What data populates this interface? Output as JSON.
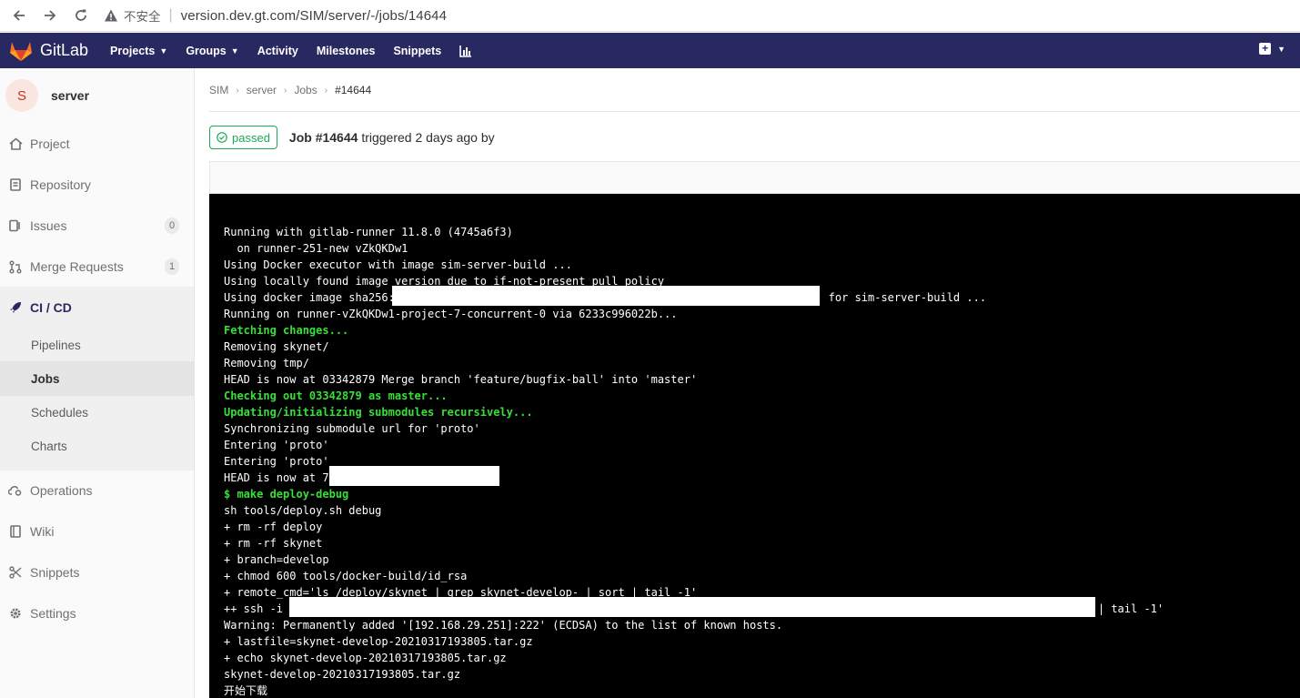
{
  "browser": {
    "insecure_label": "不安全",
    "url": "version.dev.gt.com/SIM/server/-/jobs/14644"
  },
  "topnav": {
    "brand": "GitLab",
    "items": [
      {
        "label": "Projects",
        "dropdown": true
      },
      {
        "label": "Groups",
        "dropdown": true
      },
      {
        "label": "Activity",
        "dropdown": false
      },
      {
        "label": "Milestones",
        "dropdown": false
      },
      {
        "label": "Snippets",
        "dropdown": false
      }
    ],
    "colors": {
      "background": "#292961",
      "logo_orange": "#e24329"
    }
  },
  "sidebar": {
    "project_initial": "S",
    "project_name": "server",
    "items": [
      {
        "label": "Project",
        "icon": "home-icon"
      },
      {
        "label": "Repository",
        "icon": "document-icon"
      },
      {
        "label": "Issues",
        "icon": "issues-icon",
        "count": "0"
      },
      {
        "label": "Merge Requests",
        "icon": "merge-request-icon",
        "count": "1"
      },
      {
        "label": "CI / CD",
        "icon": "rocket-icon",
        "active": true
      },
      {
        "label": "Operations",
        "icon": "cloud-gear-icon"
      },
      {
        "label": "Wiki",
        "icon": "book-icon"
      },
      {
        "label": "Snippets",
        "icon": "scissors-icon"
      },
      {
        "label": "Settings",
        "icon": "gear-icon"
      }
    ],
    "cicd_subitems": [
      {
        "label": "Pipelines"
      },
      {
        "label": "Jobs",
        "active": true
      },
      {
        "label": "Schedules"
      },
      {
        "label": "Charts"
      }
    ]
  },
  "breadcrumb": [
    "SIM",
    "server",
    "Jobs",
    "#14644"
  ],
  "job": {
    "status": "passed",
    "status_color": "#1aaa55",
    "title_strong": "Job #14644",
    "title_rest": "triggered 2 days ago by"
  },
  "trace": {
    "lines": [
      {
        "text": "Running with gitlab-runner 11.8.0 (4745a6f3)",
        "style": "normal"
      },
      {
        "text": "  on runner-251-new vZkQKDw1",
        "style": "normal"
      },
      {
        "text": "Using Docker executor with image sim-server-build ...",
        "style": "normal"
      },
      {
        "text": "Using locally found image version due to if-not-present pull policy",
        "style": "normal"
      },
      {
        "text": "Using docker image sha256:                                                                  for sim-server-build ...",
        "style": "normal"
      },
      {
        "text": "Running on runner-vZkQKDw1-project-7-concurrent-0 via 6233c996022b...",
        "style": "normal"
      },
      {
        "text": "Fetching changes...",
        "style": "green"
      },
      {
        "text": "Removing skynet/",
        "style": "normal"
      },
      {
        "text": "Removing tmp/",
        "style": "normal"
      },
      {
        "text": "HEAD is now at 03342879 Merge branch 'feature/bugfix-ball' into 'master'",
        "style": "normal"
      },
      {
        "text": "Checking out 03342879 as master...",
        "style": "green"
      },
      {
        "text": "Updating/initializing submodules recursively...",
        "style": "green"
      },
      {
        "text": "Synchronizing submodule url for 'proto'",
        "style": "normal"
      },
      {
        "text": "Entering 'proto'",
        "style": "normal"
      },
      {
        "text": "Entering 'proto'",
        "style": "normal"
      },
      {
        "text": "HEAD is now at 7",
        "style": "normal"
      },
      {
        "text": "$ make deploy-debug",
        "style": "green"
      },
      {
        "text": "sh tools/deploy.sh debug",
        "style": "normal"
      },
      {
        "text": "+ rm -rf deploy",
        "style": "normal"
      },
      {
        "text": "+ rm -rf skynet",
        "style": "normal"
      },
      {
        "text": "+ branch=develop",
        "style": "normal"
      },
      {
        "text": "+ chmod 600 tools/docker-build/id_rsa",
        "style": "normal"
      },
      {
        "text": "+ remote_cmd='ls /deploy/skynet | grep skynet-develop- | sort | tail -1'",
        "style": "normal"
      },
      {
        "text": "++ ssh -i                                                                                                                     | sort | tail -1'",
        "style": "normal"
      },
      {
        "text": "Warning: Permanently added '[192.168.29.251]:222' (ECDSA) to the list of known hosts.",
        "style": "normal"
      },
      {
        "text": "+ lastfile=skynet-develop-20210317193805.tar.gz",
        "style": "normal"
      },
      {
        "text": "+ echo skynet-develop-20210317193805.tar.gz",
        "style": "normal"
      },
      {
        "text": "skynet-develop-20210317193805.tar.gz",
        "style": "normal"
      },
      {
        "text": "开始下载",
        "style": "normal"
      }
    ]
  }
}
